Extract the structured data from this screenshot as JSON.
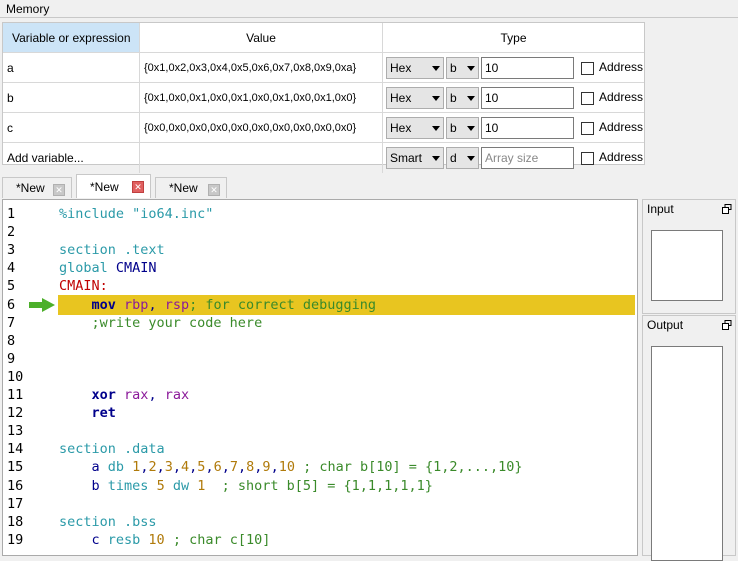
{
  "memory": {
    "title": "Memory",
    "headers": {
      "variable": "Variable or expression",
      "value": "Value",
      "type": "Type"
    },
    "rows": [
      {
        "name": "a",
        "value": "{0x1,0x2,0x3,0x4,0x5,0x6,0x7,0x8,0x9,0xa}",
        "format": "Hex",
        "size": "b",
        "count": "10",
        "count_placeholder": "",
        "address_label": "Address"
      },
      {
        "name": "b",
        "value": "{0x1,0x0,0x1,0x0,0x1,0x0,0x1,0x0,0x1,0x0}",
        "format": "Hex",
        "size": "b",
        "count": "10",
        "count_placeholder": "",
        "address_label": "Address"
      },
      {
        "name": "c",
        "value": "{0x0,0x0,0x0,0x0,0x0,0x0,0x0,0x0,0x0,0x0}",
        "format": "Hex",
        "size": "b",
        "count": "10",
        "count_placeholder": "",
        "address_label": "Address"
      },
      {
        "name": "Add variable...",
        "value": "",
        "format": "Smart",
        "size": "d",
        "count": "",
        "count_placeholder": "Array size",
        "address_label": "Address"
      }
    ]
  },
  "tabs": [
    {
      "label": "*New",
      "active": false
    },
    {
      "label": "*New",
      "active": true
    },
    {
      "label": "*New",
      "active": false
    }
  ],
  "editor": {
    "current_line": 6,
    "line_numbers": [
      "1",
      "2",
      "3",
      "4",
      "5",
      "6",
      "7",
      "8",
      "9",
      "10",
      "11",
      "12",
      "13",
      "14",
      "15",
      "16",
      "17",
      "18",
      "19"
    ],
    "lines": [
      [
        {
          "t": "%include \"io64.inc\"",
          "c": "pp"
        }
      ],
      [],
      [
        {
          "t": "section .text",
          "c": "kw"
        }
      ],
      [
        {
          "t": "global ",
          "c": "kw"
        },
        {
          "t": "CMAIN",
          "c": "id"
        }
      ],
      [
        {
          "t": "CMAIN:",
          "c": "lbl"
        }
      ],
      [
        {
          "t": "    "
        },
        {
          "t": "mov",
          "c": "ins"
        },
        {
          "t": " "
        },
        {
          "t": "rbp",
          "c": "reg"
        },
        {
          "t": ", ",
          "c": "plain"
        },
        {
          "t": "rsp",
          "c": "reg"
        },
        {
          "t": "; for correct debugging",
          "c": "cm"
        }
      ],
      [
        {
          "t": "    ;write your code here",
          "c": "cm"
        }
      ],
      [],
      [],
      [],
      [
        {
          "t": "    "
        },
        {
          "t": "xor",
          "c": "ins"
        },
        {
          "t": " "
        },
        {
          "t": "rax",
          "c": "reg"
        },
        {
          "t": ", ",
          "c": "plain"
        },
        {
          "t": "rax",
          "c": "reg"
        }
      ],
      [
        {
          "t": "    "
        },
        {
          "t": "ret",
          "c": "ins"
        }
      ],
      [],
      [
        {
          "t": "section .data",
          "c": "kw"
        }
      ],
      [
        {
          "t": "    a ",
          "c": "plain"
        },
        {
          "t": "db ",
          "c": "kw"
        },
        {
          "t": "1",
          "c": "nm"
        },
        {
          "t": ",",
          "c": "plain"
        },
        {
          "t": "2",
          "c": "nm"
        },
        {
          "t": ",",
          "c": "plain"
        },
        {
          "t": "3",
          "c": "nm"
        },
        {
          "t": ",",
          "c": "plain"
        },
        {
          "t": "4",
          "c": "nm"
        },
        {
          "t": ",",
          "c": "plain"
        },
        {
          "t": "5",
          "c": "nm"
        },
        {
          "t": ",",
          "c": "plain"
        },
        {
          "t": "6",
          "c": "nm"
        },
        {
          "t": ",",
          "c": "plain"
        },
        {
          "t": "7",
          "c": "nm"
        },
        {
          "t": ",",
          "c": "plain"
        },
        {
          "t": "8",
          "c": "nm"
        },
        {
          "t": ",",
          "c": "plain"
        },
        {
          "t": "9",
          "c": "nm"
        },
        {
          "t": ",",
          "c": "plain"
        },
        {
          "t": "10",
          "c": "nm"
        },
        {
          "t": " ; char b[10] = {1,2,...,10}",
          "c": "cm"
        }
      ],
      [
        {
          "t": "    b ",
          "c": "plain"
        },
        {
          "t": "times ",
          "c": "kw"
        },
        {
          "t": "5",
          "c": "nm"
        },
        {
          "t": " dw ",
          "c": "kw"
        },
        {
          "t": "1",
          "c": "nm"
        },
        {
          "t": "  ; short b[5] = {1,1,1,1,1}",
          "c": "cm"
        }
      ],
      [],
      [
        {
          "t": "section .bss",
          "c": "kw"
        }
      ],
      [
        {
          "t": "    c ",
          "c": "plain"
        },
        {
          "t": "resb ",
          "c": "kw"
        },
        {
          "t": "10",
          "c": "nm"
        },
        {
          "t": " ; char c[10]",
          "c": "cm"
        }
      ]
    ]
  },
  "side": {
    "input_title": "Input",
    "output_title": "Output",
    "restore_icon": "restore-icon"
  },
  "colors": {
    "highlight": "#e8c520",
    "arrow": "#4caf2a",
    "header_selected": "#cce4f7"
  }
}
